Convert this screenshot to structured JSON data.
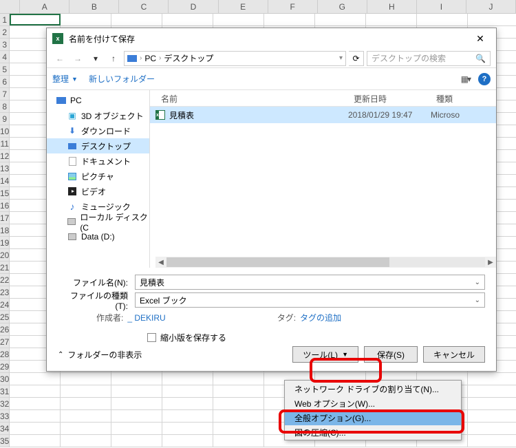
{
  "col_headers": [
    "A",
    "B",
    "C",
    "D",
    "E",
    "F",
    "G",
    "H",
    "I",
    "J"
  ],
  "row_count": 35,
  "dialog": {
    "title": "名前を付けて保存",
    "path": {
      "pc": "PC",
      "location": "デスクトップ"
    },
    "search_placeholder": "デスクトップの検索",
    "toolbar": {
      "organize": "整理",
      "newfolder": "新しいフォルダー"
    },
    "tree": {
      "pc": "PC",
      "items": [
        {
          "label": "3D オブジェクト",
          "icon": "3d"
        },
        {
          "label": "ダウンロード",
          "icon": "dl"
        },
        {
          "label": "デスクトップ",
          "icon": "desk",
          "selected": true
        },
        {
          "label": "ドキュメント",
          "icon": "doc"
        },
        {
          "label": "ピクチャ",
          "icon": "pic"
        },
        {
          "label": "ビデオ",
          "icon": "vid"
        },
        {
          "label": "ミュージック",
          "icon": "music"
        },
        {
          "label": "ローカル ディスク (C",
          "icon": "disk"
        },
        {
          "label": "Data (D:)",
          "icon": "disk"
        }
      ]
    },
    "filelist": {
      "cols": {
        "name": "名前",
        "date": "更新日時",
        "type": "種類"
      },
      "rows": [
        {
          "name": "見積表",
          "date": "2018/01/29 19:47",
          "type": "Microso",
          "selected": true
        }
      ]
    },
    "form": {
      "filename_label": "ファイル名(N):",
      "filename_value": "見積表",
      "filetype_label": "ファイルの種類(T):",
      "filetype_value": "Excel ブック",
      "author_label": "作成者:",
      "author_value": "_ DEKIRU",
      "tag_label": "タグ:",
      "tag_value": "タグの追加",
      "thumbnail": "縮小版を保存する"
    },
    "buttons": {
      "hide_folders": "フォルダーの非表示",
      "tools": "ツール(L)",
      "save": "保存(S)",
      "cancel": "キャンセル"
    }
  },
  "menu": {
    "items": [
      "ネットワーク ドライブの割り当て(N)...",
      "Web オプション(W)...",
      "全般オプション(G)...",
      "図の圧縮(C)..."
    ],
    "selected_index": 2
  }
}
